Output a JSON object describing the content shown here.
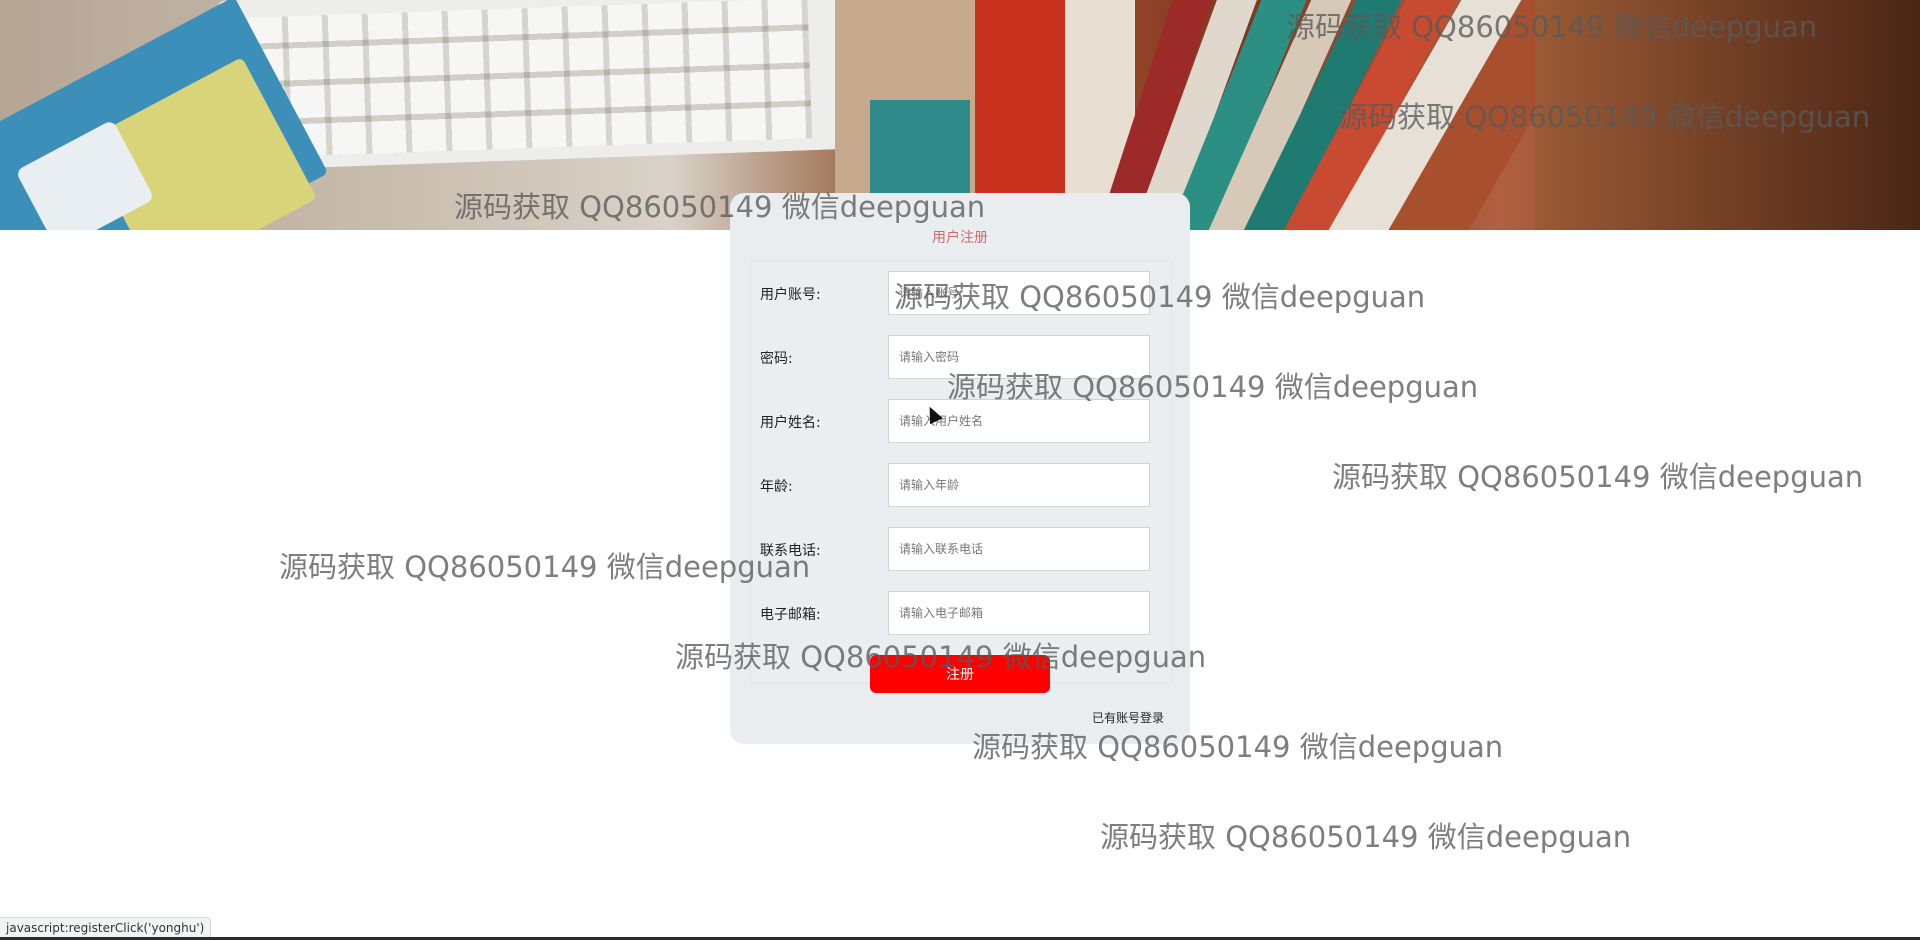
{
  "form": {
    "title": "用户注册",
    "fields": [
      {
        "label": "用户账号:",
        "placeholder": "请输入账号"
      },
      {
        "label": "密码:",
        "placeholder": "请输入密码"
      },
      {
        "label": "用户姓名:",
        "placeholder": "请输入用户姓名"
      },
      {
        "label": "年龄:",
        "placeholder": "请输入年龄"
      },
      {
        "label": "联系电话:",
        "placeholder": "请输入联系电话"
      },
      {
        "label": "电子邮箱:",
        "placeholder": "请输入电子邮箱"
      }
    ],
    "submit_label": "注册",
    "login_link": "已有账号登录"
  },
  "watermark_text": "源码获取 QQ86050149 微信deepguan",
  "status_bar": "javascript:registerClick('yonghu')",
  "colors": {
    "accent": "#ff0000",
    "card_bg": "#e9edf0",
    "title": "#d06a6a"
  }
}
